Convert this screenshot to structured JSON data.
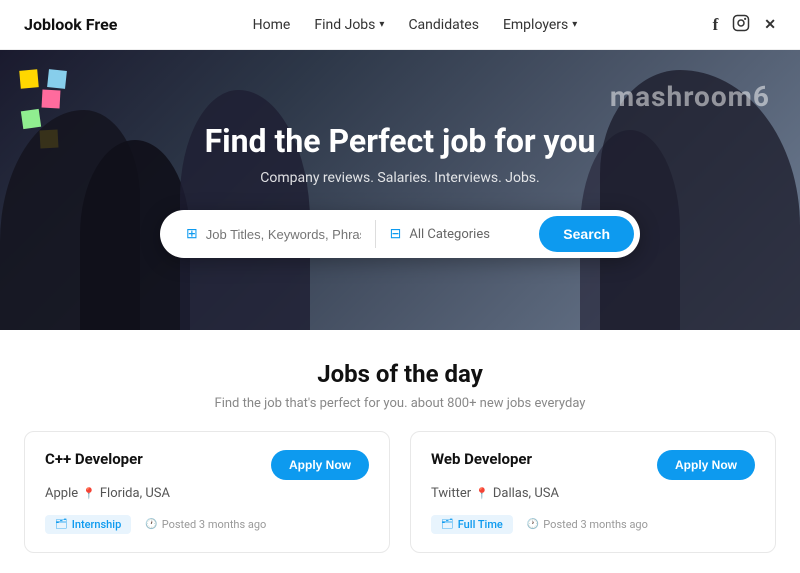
{
  "nav": {
    "brand": "Joblook Free",
    "links": [
      {
        "label": "Home",
        "hasDropdown": false
      },
      {
        "label": "Find Jobs",
        "hasDropdown": true
      },
      {
        "label": "Candidates",
        "hasDropdown": false
      },
      {
        "label": "Employers",
        "hasDropdown": true
      }
    ],
    "socialIcons": [
      "facebook-icon",
      "instagram-icon",
      "x-icon"
    ]
  },
  "hero": {
    "wallText": "mashroom6",
    "title": "Find the Perfect job for you",
    "subtitle": "Company reviews. Salaries. Interviews. Jobs.",
    "search": {
      "placeholder": "Job Titles, Keywords, Phrase",
      "categoryPlaceholder": "All Categories",
      "buttonLabel": "Search"
    }
  },
  "jobs": {
    "title": "Jobs of the day",
    "subtitle": "Find the job that's perfect for you. about 800+ new jobs everyday",
    "cards": [
      {
        "title": "C++ Developer",
        "company": "Apple",
        "location": "Florida, USA",
        "applyLabel": "Apply Now",
        "tag": "Internship",
        "tagType": "internship",
        "postedTime": "Posted 3 months ago"
      },
      {
        "title": "Web Developer",
        "company": "Twitter",
        "location": "Dallas, USA",
        "applyLabel": "Apply Now",
        "tag": "Full Time",
        "tagType": "fulltime",
        "postedTime": "Posted 3 months ago"
      }
    ]
  }
}
